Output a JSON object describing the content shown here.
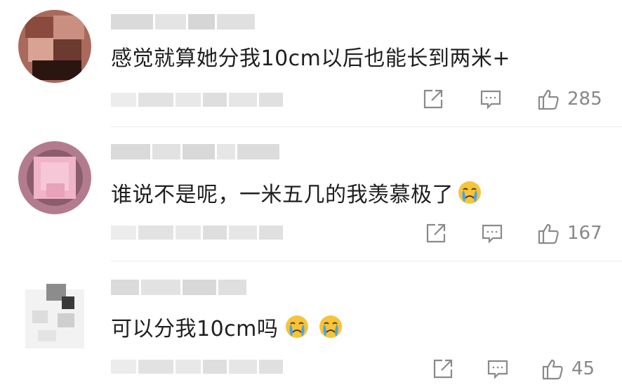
{
  "comments": [
    {
      "text": "感觉就算她分我10cm以后也能长到两米+",
      "likes": "285",
      "avatar_colors": [
        "#5a2f25",
        "#c0867a",
        "#2a1512"
      ]
    },
    {
      "text": "谁说不是呢，一米五几的我羡慕极了",
      "likes": "167",
      "avatar_colors": [
        "#efaec4",
        "#d48da6",
        "#8f5f6f"
      ]
    },
    {
      "text": "可以分我10cm吗",
      "likes": "45",
      "avatar_colors": [
        "#dcdcdc",
        "#8c8c8c",
        "#ffffff"
      ]
    }
  ],
  "icons": {
    "share": "share-icon",
    "reply": "comment-icon",
    "like": "thumbs-up-icon",
    "emoji": "crying-face-emoji"
  },
  "colors": {
    "text": "#1f1f1f",
    "icon": "#8a8a8a",
    "emoji_face": "#f5c43b",
    "emoji_tear": "#4aa3e8"
  }
}
